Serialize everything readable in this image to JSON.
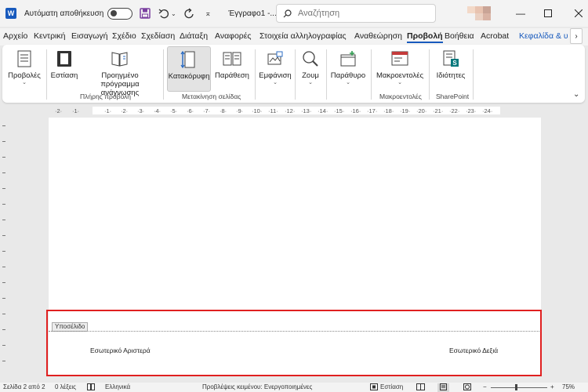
{
  "titlebar": {
    "autosave_label": "Αυτόματη αποθήκευση",
    "doc_title": "Έγγραφο1  -...",
    "search_placeholder": "Αναζήτηση"
  },
  "menu": {
    "tabs": [
      "Αρχείο",
      "Κεντρική",
      "Εισαγωγή",
      "Σχέδιο",
      "Σχεδίαση",
      "Διάταξη",
      "Αναφορές",
      "Στοιχεία αλληλογραφίας",
      "Αναθεώρηση",
      "Προβολή",
      "Βοήθεια",
      "Acrobat",
      "Κεφαλίδα & υ"
    ],
    "active": "Προβολή"
  },
  "ribbon": {
    "views": "Προβολές",
    "focus": "Εστίαση",
    "reader_line1": "Προηγμένο",
    "reader_line2": "πρόγραμμα ανάγνωσης",
    "vertical": "Κατακόρυφη",
    "side_to_side": "Παράθεση",
    "show": "Εμφάνιση",
    "zoom": "Ζουμ",
    "window": "Παράθυρο",
    "macros": "Μακροεντολές",
    "properties": "Ιδιότητες",
    "group_immersive": "Πλήρης προβολή",
    "group_page_movement": "Μετακίνηση σελίδας",
    "group_macros": "Μακροεντολές",
    "group_sharepoint": "SharePoint"
  },
  "ruler": {
    "ticks": [
      "·2·",
      "·1·",
      "·1·",
      "·2·",
      "·3·",
      "·4·",
      "·5·",
      "·6·",
      "·7·",
      "·8·",
      "·9·",
      "·10·",
      "·11·",
      "·12·",
      "·13·",
      "·14·",
      "·15·",
      "·16·",
      "·17·",
      "·18·",
      "·19·",
      "·20·",
      "·21·",
      "·22·",
      "·23·",
      "·24·"
    ]
  },
  "page": {
    "footer_tag": "Υποσέλιδο",
    "footer_left": "Εσωτερικό Αριστερά",
    "footer_right": "Εσωτερικό Δεξιά"
  },
  "status": {
    "page_info": "Σελίδα 2 από 2",
    "words": "0 λέξεις",
    "language": "Ελληνικά",
    "predictions": "Προβλέψεις κειμένου: Ενεργοποιημένες",
    "focus": "Εστίαση",
    "zoom_value": "75%"
  },
  "colors": {
    "accent": "#185abd",
    "highlight_border": "#e02020"
  }
}
